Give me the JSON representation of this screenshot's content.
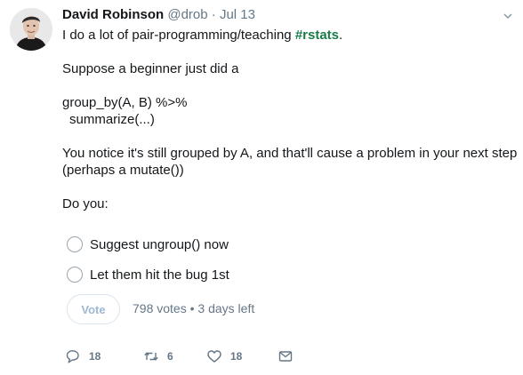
{
  "author": {
    "name": "David Robinson",
    "handle": "@drob",
    "separator": "·",
    "date": "Jul 13"
  },
  "tweet": {
    "line1_prefix": "I do a lot of pair-programming/teaching ",
    "line1_hashtag": "#rstats",
    "line1_suffix": ".",
    "line2": "Suppose a beginner just did a",
    "code1": "group_by(A, B) %>%",
    "code2": "summarize(...)",
    "line3": "You notice it's still grouped by A, and that'll cause a problem in your next step",
    "line4": "(perhaps a mutate())",
    "line5": "Do you:"
  },
  "poll": {
    "options": [
      {
        "label": "Suggest ungroup() now"
      },
      {
        "label": "Let them hit the bug 1st"
      }
    ],
    "vote_label": "Vote",
    "votes": "798 votes",
    "bullet": "•",
    "time_left": "3 days left"
  },
  "actions": {
    "reply_count": "18",
    "retweet_count": "6",
    "like_count": "18"
  },
  "icons": {
    "avatar": "avatar-photo",
    "caret": "chevron-down-icon",
    "reply": "reply-icon",
    "retweet": "retweet-icon",
    "like": "heart-icon",
    "dm": "envelope-icon"
  },
  "colors": {
    "hashtag": "#1b7c4a",
    "muted": "#657786",
    "vote_text": "#9fb8d3"
  }
}
